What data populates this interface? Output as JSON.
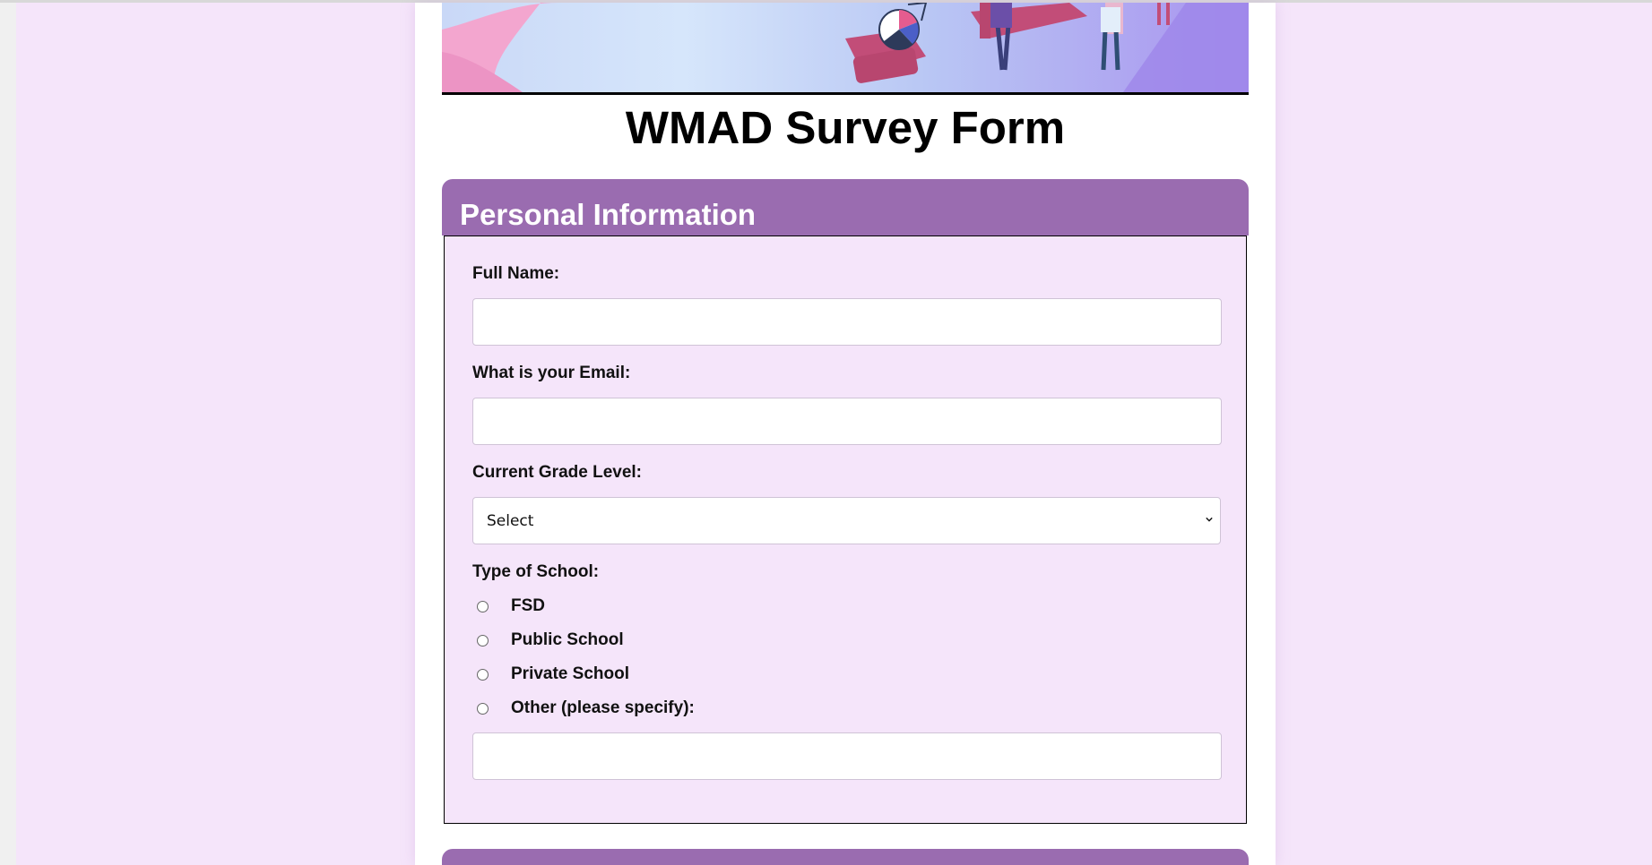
{
  "form": {
    "title": "WMAD Survey Form"
  },
  "section": {
    "title": "Personal Information",
    "full_name_label": "Full Name:",
    "full_name_value": "",
    "email_label": "What is your Email:",
    "email_value": "",
    "grade_label": "Current Grade Level:",
    "grade_selected": "Select",
    "school_type_label": "Type of School:",
    "school_options": [
      {
        "label": "FSD",
        "checked": false
      },
      {
        "label": "Public School",
        "checked": false
      },
      {
        "label": "Private School",
        "checked": false
      },
      {
        "label": "Other (please specify):",
        "checked": false
      }
    ],
    "other_value": ""
  },
  "colors": {
    "page_background": "#f5e5fa",
    "section_header": "#9a6cb0",
    "section_body": "#f5e5fa",
    "container": "#ffffff"
  },
  "icons": {
    "select_chevron": "chevron-down-icon"
  }
}
